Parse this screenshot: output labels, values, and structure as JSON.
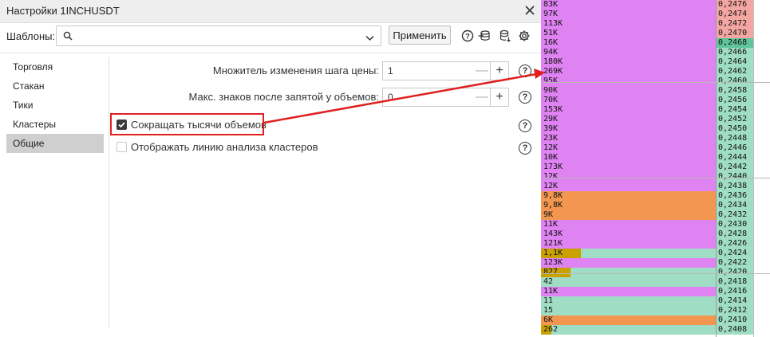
{
  "dialog": {
    "title": "Настройки 1INCHUSDT",
    "templates_label": "Шаблоны:",
    "template_value": "",
    "apply_label": "Применить"
  },
  "sidebar": {
    "items": [
      {
        "label": "Торговля",
        "active": false
      },
      {
        "label": "Стакан",
        "active": false
      },
      {
        "label": "Тики",
        "active": false
      },
      {
        "label": "Кластеры",
        "active": false
      },
      {
        "label": "Общие",
        "active": true
      }
    ]
  },
  "settings": {
    "step_multiplier_label": "Множитель изменения шага цены:",
    "step_multiplier_value": "1",
    "max_decimals_label": "Макс. знаков после запятой у объемов:",
    "max_decimals_value": "0",
    "shorten_thousands_label": "Сокращать тысячи объемов",
    "shorten_thousands_checked": true,
    "show_cluster_line_label": "Отображать линию анализа кластеров",
    "show_cluster_line_checked": false,
    "help_glyph": "?",
    "minus_glyph": "—",
    "plus_glyph": "+"
  },
  "colors": {
    "purple": "#df82f2",
    "orange": "#f29650",
    "gold": "#c9a100",
    "teal": "#a0ddc5",
    "pink": "#f4a7a2",
    "green": "#5fc49b",
    "red_annotation": "#e02020"
  },
  "orderbook": {
    "rows": [
      {
        "vol": "83K",
        "price": "0,2476",
        "bar": 1.0,
        "color": "purple",
        "pcolor": "pink"
      },
      {
        "vol": "97K",
        "price": "0,2474",
        "bar": 1.0,
        "color": "purple",
        "pcolor": "pink"
      },
      {
        "vol": "113K",
        "price": "0,2472",
        "bar": 1.0,
        "color": "purple",
        "pcolor": "pink"
      },
      {
        "vol": "51K",
        "price": "0,2470",
        "bar": 1.0,
        "color": "purple",
        "pcolor": "pink"
      },
      {
        "vol": "16K",
        "price": "0,2468",
        "bar": 1.0,
        "color": "purple",
        "pcolor": "green"
      },
      {
        "vol": "94K",
        "price": "0,2466",
        "bar": 1.0,
        "color": "purple",
        "pcolor": "teal"
      },
      {
        "vol": "180K",
        "price": "0,2464",
        "bar": 1.0,
        "color": "purple",
        "pcolor": "teal"
      },
      {
        "vol": "269K",
        "price": "0,2462",
        "bar": 1.0,
        "color": "purple",
        "pcolor": "teal"
      },
      {
        "vol": "95K",
        "price": "0,2460",
        "bar": 1.0,
        "color": "purple",
        "pcolor": "teal"
      },
      {
        "vol": "90K",
        "price": "0,2458",
        "bar": 1.0,
        "color": "purple",
        "pcolor": "teal"
      },
      {
        "vol": "70K",
        "price": "0,2456",
        "bar": 1.0,
        "color": "purple",
        "pcolor": "teal"
      },
      {
        "vol": "153K",
        "price": "0,2454",
        "bar": 1.0,
        "color": "purple",
        "pcolor": "teal"
      },
      {
        "vol": "29K",
        "price": "0,2452",
        "bar": 1.0,
        "color": "purple",
        "pcolor": "teal"
      },
      {
        "vol": "39K",
        "price": "0,2450",
        "bar": 1.0,
        "color": "purple",
        "pcolor": "teal"
      },
      {
        "vol": "23K",
        "price": "0,2448",
        "bar": 1.0,
        "color": "purple",
        "pcolor": "teal"
      },
      {
        "vol": "12K",
        "price": "0,2446",
        "bar": 1.0,
        "color": "purple",
        "pcolor": "teal"
      },
      {
        "vol": "10K",
        "price": "0,2444",
        "bar": 1.0,
        "color": "purple",
        "pcolor": "teal"
      },
      {
        "vol": "173K",
        "price": "0,2442",
        "bar": 1.0,
        "color": "purple",
        "pcolor": "teal"
      },
      {
        "vol": "12K",
        "price": "0,2440",
        "bar": 1.0,
        "color": "purple",
        "pcolor": "teal"
      },
      {
        "vol": "12K",
        "price": "0,2438",
        "bar": 1.0,
        "color": "purple",
        "pcolor": "teal"
      },
      {
        "vol": "9,8K",
        "price": "0,2436",
        "bar": 1.0,
        "color": "orange",
        "pcolor": "teal"
      },
      {
        "vol": "9,8K",
        "price": "0,2434",
        "bar": 1.0,
        "color": "orange",
        "pcolor": "teal"
      },
      {
        "vol": "9K",
        "price": "0,2432",
        "bar": 1.0,
        "color": "orange",
        "pcolor": "teal"
      },
      {
        "vol": "11K",
        "price": "0,2430",
        "bar": 1.0,
        "color": "purple",
        "pcolor": "teal"
      },
      {
        "vol": "143K",
        "price": "0,2428",
        "bar": 1.0,
        "color": "purple",
        "pcolor": "teal"
      },
      {
        "vol": "121K",
        "price": "0,2426",
        "bar": 1.0,
        "color": "purple",
        "pcolor": "teal"
      },
      {
        "vol": "1,1K",
        "price": "0,2424",
        "bar": 0.23,
        "color": "gold",
        "pcolor": "teal",
        "rest": "teal"
      },
      {
        "vol": "123K",
        "price": "0,2422",
        "bar": 1.0,
        "color": "purple",
        "pcolor": "teal"
      },
      {
        "vol": "827",
        "price": "0,2420",
        "bar": 0.17,
        "color": "gold",
        "pcolor": "teal",
        "rest": "teal"
      },
      {
        "vol": "42",
        "price": "0,2418",
        "bar": 1.0,
        "color": "teal",
        "pcolor": "teal"
      },
      {
        "vol": "11K",
        "price": "0,2416",
        "bar": 1.0,
        "color": "purple",
        "pcolor": "teal"
      },
      {
        "vol": "11",
        "price": "0,2414",
        "bar": 1.0,
        "color": "teal",
        "pcolor": "teal"
      },
      {
        "vol": "15",
        "price": "0,2412",
        "bar": 1.0,
        "color": "teal",
        "pcolor": "teal"
      },
      {
        "vol": "6K",
        "price": "0,2410",
        "bar": 1.0,
        "color": "orange",
        "pcolor": "teal"
      },
      {
        "vol": "262",
        "price": "0,2408",
        "bar": 0.06,
        "color": "gold",
        "pcolor": "teal",
        "rest": "teal"
      }
    ]
  }
}
